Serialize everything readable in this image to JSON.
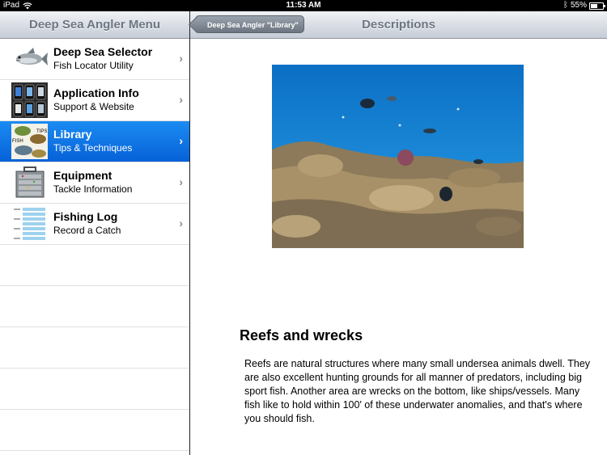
{
  "status": {
    "device": "iPad",
    "time": "11:53 AM",
    "battery": "55%",
    "battery_level": 0.55
  },
  "master": {
    "title": "Deep Sea Angler Menu",
    "items": [
      {
        "title": "Deep Sea Selector",
        "subtitle": "Fish Locator Utility",
        "icon": "fish-icon"
      },
      {
        "title": "Application Info",
        "subtitle": "Support & Website",
        "icon": "phones-icon"
      },
      {
        "title": "Library",
        "subtitle": "Tips & Techniques",
        "icon": "fish-tips-icon"
      },
      {
        "title": "Equipment",
        "subtitle": "Tackle Information",
        "icon": "tackle-box-icon"
      },
      {
        "title": "Fishing Log",
        "subtitle": "Record a Catch",
        "icon": "log-sheet-icon"
      }
    ],
    "selected_index": 2
  },
  "detail": {
    "back_label": "Deep Sea Angler \"Library\"",
    "title": "Descriptions",
    "image": "reef-photo",
    "heading": "Reefs and wrecks",
    "body": "Reefs are natural structures where many small undersea animals dwell. They are also excellent hunting grounds for all manner of predators, including big sport fish. Another area are wrecks on the bottom, like ships/vessels. Many fish like to hold within 100' of these underwater anomalies, and that's where you should fish."
  },
  "colors": {
    "selection": "#0a6fe4",
    "nav_bar": "#c5ccd6",
    "nav_text": "#6d7683"
  }
}
